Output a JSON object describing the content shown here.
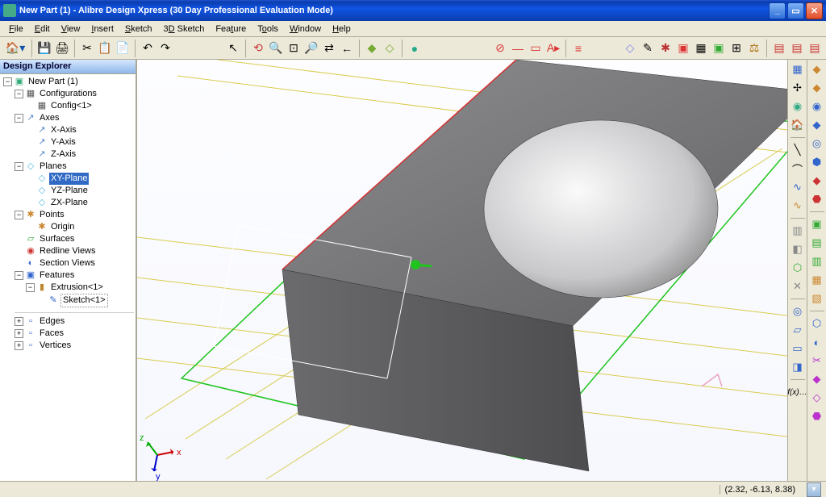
{
  "title": "New Part (1) - Alibre Design Xpress (30 Day Professional Evaluation Mode)",
  "menus": [
    "File",
    "Edit",
    "View",
    "Insert",
    "Sketch",
    "3D Sketch",
    "Feature",
    "Tools",
    "Window",
    "Help"
  ],
  "explorer": {
    "title": "Design Explorer",
    "root": "New Part (1)",
    "configurations": "Configurations",
    "config1": "Config<1>",
    "axes": "Axes",
    "xaxis": "X-Axis",
    "yaxis": "Y-Axis",
    "zaxis": "Z-Axis",
    "planes": "Planes",
    "xyplane": "XY-Plane",
    "yzplane": "YZ-Plane",
    "zxplane": "ZX-Plane",
    "points": "Points",
    "origin": "Origin",
    "surfaces": "Surfaces",
    "redline": "Redline Views",
    "section": "Section Views",
    "features": "Features",
    "extrusion": "Extrusion<1>",
    "sketch1": "Sketch<1>",
    "edges": "Edges",
    "faces": "Faces",
    "vertices": "Vertices"
  },
  "status": {
    "coords": "(2.32, -6.13, 8.38)"
  }
}
